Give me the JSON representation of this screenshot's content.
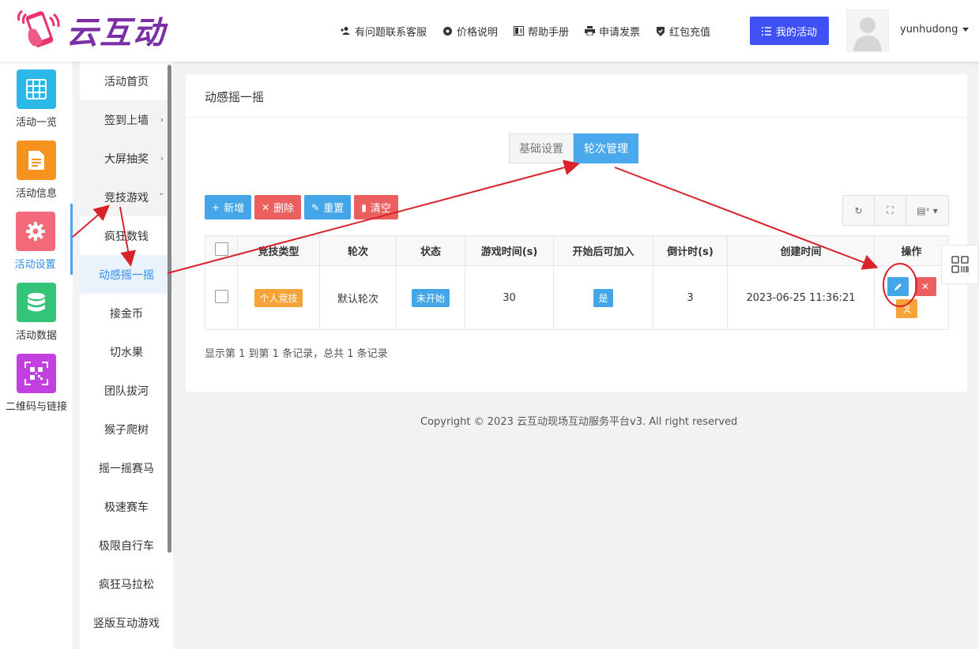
{
  "header": {
    "logo_text": "云互动",
    "nav": [
      {
        "label": "有问题联系客服",
        "icon": "add-user-icon"
      },
      {
        "label": "价格说明",
        "icon": "settings-icon"
      },
      {
        "label": "帮助手册",
        "icon": "book-icon"
      },
      {
        "label": "申请发票",
        "icon": "printer-icon"
      },
      {
        "label": "红包充值",
        "icon": "shield-check-icon"
      }
    ],
    "my_activity_label": "我的活动",
    "username": "yunhudong"
  },
  "icon_sidebar": [
    {
      "label": "活动一览",
      "icon": "grid-icon",
      "color": "#29b8e8"
    },
    {
      "label": "活动信息",
      "icon": "document-icon",
      "color": "#f5931e"
    },
    {
      "label": "活动设置",
      "icon": "gear-icon",
      "color": "#f36a7b",
      "active": true
    },
    {
      "label": "活动数据",
      "icon": "database-icon",
      "color": "#33c47a"
    },
    {
      "label": "二维码与链接",
      "icon": "qrcode-icon",
      "color": "#c340e0"
    }
  ],
  "submenu": [
    {
      "label": "活动首页"
    },
    {
      "label": "签到上墙",
      "chevron": "›"
    },
    {
      "label": "大屏抽奖",
      "chevron": "›"
    },
    {
      "label": "竞技游戏",
      "chevron": "˅"
    },
    {
      "label": "疯狂数钱"
    },
    {
      "label": "动感摇一摇",
      "active": true
    },
    {
      "label": "接金币"
    },
    {
      "label": "切水果"
    },
    {
      "label": "团队拔河"
    },
    {
      "label": "猴子爬树"
    },
    {
      "label": "摇一摇赛马"
    },
    {
      "label": "极速赛车"
    },
    {
      "label": "极限自行车"
    },
    {
      "label": "疯狂马拉松"
    },
    {
      "label": "竖版互动游戏"
    }
  ],
  "main": {
    "title": "动感摇一摇",
    "tabs": [
      {
        "label": "基础设置",
        "active": false
      },
      {
        "label": "轮次管理",
        "active": true
      }
    ],
    "toolbar": {
      "add": "新增",
      "delete": "删除",
      "reset": "重置",
      "clear": "清空"
    },
    "table": {
      "headers": [
        "竞技类型",
        "轮次",
        "状态",
        "游戏时间(s)",
        "开始后可加入",
        "倒计时(s)",
        "创建时间",
        "操作"
      ],
      "rows": [
        {
          "type": "个人竞技",
          "round": "默认轮次",
          "status": "未开始",
          "game_time": "30",
          "join_after_start": "是",
          "countdown": "3",
          "created": "2023-06-25 11:36:21"
        }
      ]
    },
    "pager_text": "显示第 1 到第 1 条记录，总共 1 条记录"
  },
  "footer": {
    "copyright": "Copyright © 2023 云互动现场互动服务平台v3. All right reserved"
  },
  "colors": {
    "accent_blue": "#3f51f5",
    "info_blue": "#44a6e8",
    "danger_red": "#ec5f5f",
    "warning_orange": "#f6a43a",
    "annotation_red": "#d9232a"
  }
}
